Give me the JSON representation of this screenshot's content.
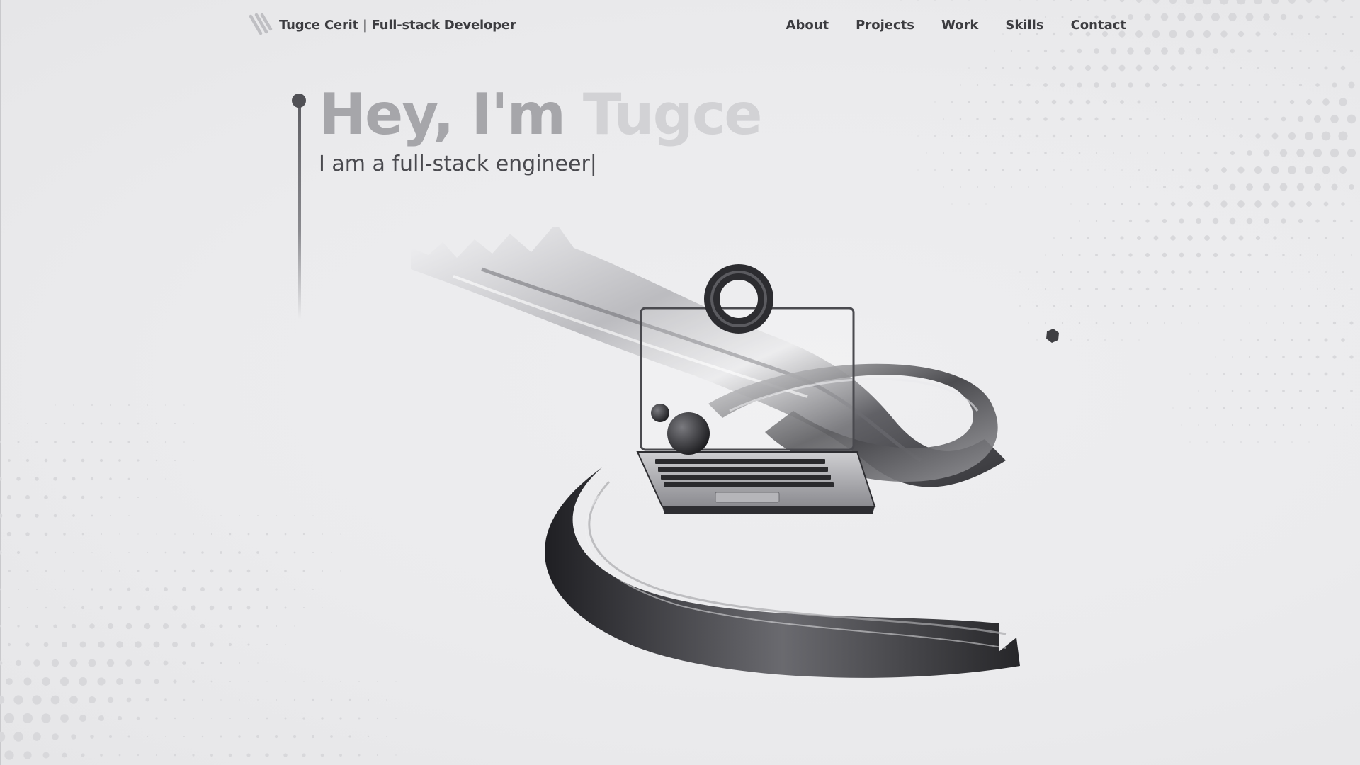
{
  "brand": {
    "name": "Tugce Cerit | Full-stack Developer",
    "logo_icon": "stripes-logo-icon"
  },
  "nav": {
    "items": [
      {
        "label": "About"
      },
      {
        "label": "Projects"
      },
      {
        "label": "Work"
      },
      {
        "label": "Skills"
      },
      {
        "label": "Contact"
      }
    ]
  },
  "hero": {
    "greeting": "Hey, I'm",
    "name": "Tugce",
    "subtitle": "I am a full-stack engineer|"
  },
  "illustration": {
    "icon": "abstract-ribbon-laptop-illustration"
  },
  "colors": {
    "background": "#ececee",
    "text_dark": "#3c3c40",
    "greeting": "#a6a6aa",
    "name": "#d2d2d5"
  }
}
